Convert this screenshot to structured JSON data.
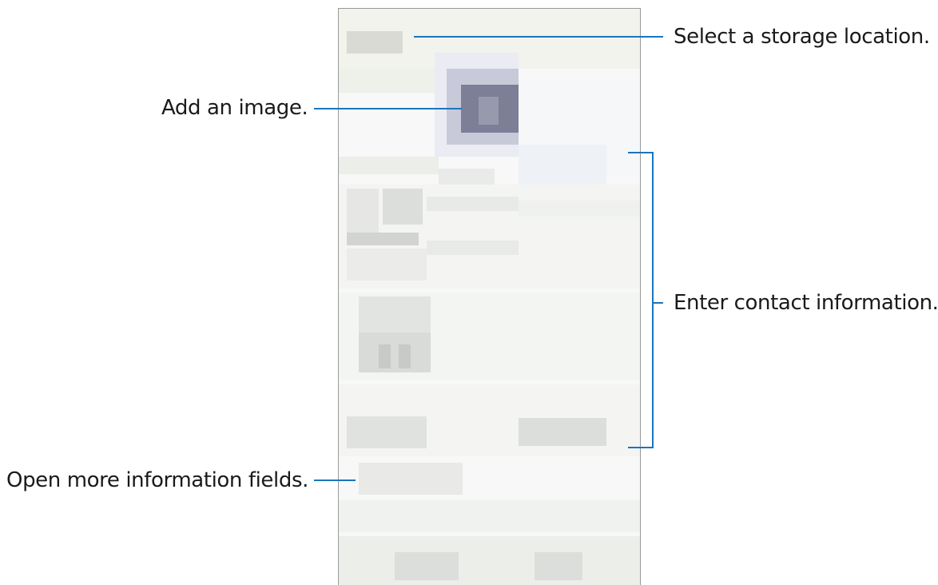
{
  "callouts": {
    "storage": "Select a storage location.",
    "image": "Add an image.",
    "contact": "Enter contact information.",
    "more_fields": "Open more information fields."
  },
  "colors": {
    "callout_line": "#1b75bc",
    "avatar": "#7c7f96"
  },
  "icons": {
    "avatar": "person-avatar-icon"
  }
}
